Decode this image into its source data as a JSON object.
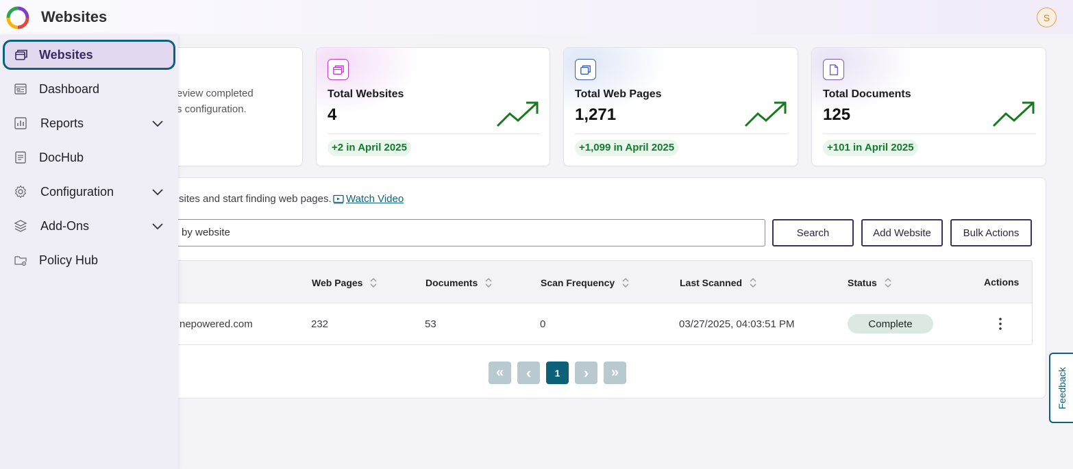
{
  "app": {
    "title": "Websites",
    "avatar_initial": "S"
  },
  "sidebar": {
    "items": [
      {
        "label": "Websites",
        "icon": "browser-windows-icon",
        "active": true
      },
      {
        "label": "Dashboard",
        "icon": "dashboard-icon"
      },
      {
        "label": "Reports",
        "icon": "reports-icon",
        "expandable": true
      },
      {
        "label": "DocHub",
        "icon": "document-icon"
      },
      {
        "label": "Configuration",
        "icon": "gear-icon",
        "expandable": true
      },
      {
        "label": "Add-Ons",
        "icon": "layers-icon",
        "expandable": true
      },
      {
        "label": "Policy Hub",
        "icon": "folder-gear-icon"
      }
    ]
  },
  "intro": {
    "line1": "eview completed",
    "line2": "s configuration."
  },
  "stats": [
    {
      "title": "Total Websites",
      "value": "4",
      "delta": "+2 in April 2025",
      "icon": "browser-windows-icon",
      "accent": "#c23bc9"
    },
    {
      "title": "Total Web Pages",
      "value": "1,271",
      "delta": "+1,099 in April 2025",
      "icon": "stacked-windows-icon",
      "accent": "#3a5fa8"
    },
    {
      "title": "Total Documents",
      "value": "125",
      "delta": "+101 in April 2025",
      "icon": "document-icon",
      "accent": "#7a5bb0"
    }
  ],
  "panel": {
    "description": "sites and start finding web pages.",
    "watch_video": "Watch Video",
    "search_placeholder": "by website",
    "buttons": {
      "search": "Search",
      "add": "Add Website",
      "bulk": "Bulk Actions"
    }
  },
  "table": {
    "headers": {
      "web_pages": "Web Pages",
      "documents": "Documents",
      "scan_frequency": "Scan Frequency",
      "last_scanned": "Last Scanned",
      "status": "Status",
      "actions": "Actions"
    },
    "rows": [
      {
        "website": "nepowered.com",
        "web_pages": "232",
        "documents": "53",
        "scan_frequency": "0",
        "last_scanned": "03/27/2025, 04:03:51 PM",
        "status": "Complete"
      }
    ]
  },
  "pagination": {
    "first": "«",
    "prev": "‹",
    "current": "1",
    "next": "›",
    "last": "»"
  },
  "feedback_label": "Feedback",
  "colors": {
    "primary": "#0d6178",
    "trend_green": "#167a1e",
    "delta_green": "#157a2e"
  }
}
